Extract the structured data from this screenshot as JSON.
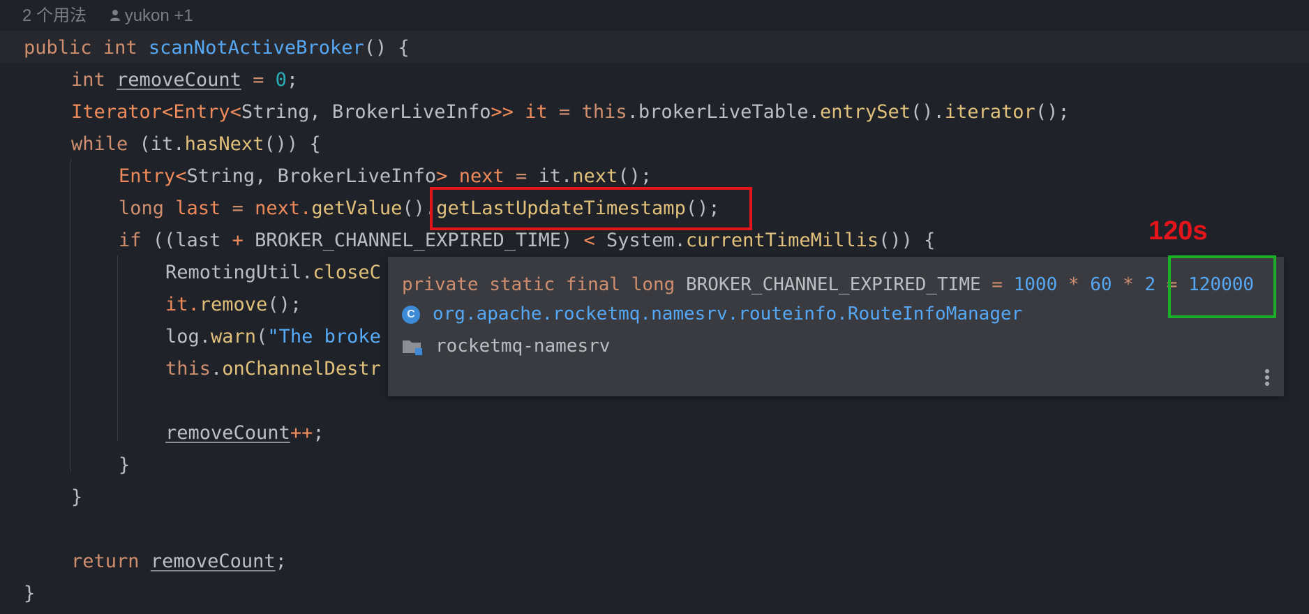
{
  "usage": {
    "count_label": "2 个用法",
    "author": "yukon +1"
  },
  "code": {
    "l1": {
      "kw1": "public",
      "kw2": "int",
      "name": "scanNotActiveBroker",
      "rest": "() {"
    },
    "l2": {
      "kw": "int",
      "var": "removeCount",
      "eq": " = ",
      "num": "0",
      "end": ";"
    },
    "l3": {
      "t1": "Iterator",
      "t2": "<",
      "t3": "Entry",
      "t4": "<",
      "t5": "String, BrokerLiveInfo",
      "t6": ">>",
      "var": " it",
      "eq": " = ",
      "kw": "this",
      "dot1": ".brokerLiveTable.",
      "m1": "entrySet",
      "p1": "().",
      "m2": "iterator",
      "end": "();"
    },
    "l4": {
      "kw": "while",
      "a": " (it.",
      "m": "hasNext",
      "b": "()) {"
    },
    "l5": {
      "t1": "Entry",
      "t2": "<",
      "t3": "String, BrokerLiveInfo",
      "t4": ">",
      "var": " next",
      "eq": " = ",
      "a": "it.",
      "m": "next",
      "end": "();"
    },
    "l6": {
      "kw": "long",
      "var": " last",
      "eq": " = ",
      "a": "next.",
      "m1": "getValue",
      "b": "().",
      "m2": "getLastUpdateTimestamp",
      "end": "();"
    },
    "l7": {
      "kw": "if",
      "a": " ((last ",
      "op": "+",
      "b": " BROKER_CHANNEL_EXPIRED_TIME) ",
      "op2": "<",
      "c": " System.",
      "m": "currentTimeMillis",
      "end": "()) {"
    },
    "l8": {
      "a": "RemotingUtil.",
      "m": "closeC"
    },
    "l9": {
      "a": "it.",
      "m": "remove",
      "end": "();"
    },
    "l10": {
      "a": "log.",
      "m": "warn",
      "b": "(",
      "s": "\"The broke"
    },
    "l11": {
      "kw": "this",
      "a": ".",
      "m": "onChannelDestr"
    },
    "l13": {
      "var": "removeCount",
      "op": "++",
      "end": ";"
    },
    "l14": {
      "t": "}"
    },
    "l15": {
      "t": "}"
    },
    "l17": {
      "kw": "return",
      "var": "removeCount",
      "end": ";"
    },
    "l18": {
      "t": "}"
    }
  },
  "annotation": {
    "label": "120s",
    "color": "#e3151b"
  },
  "popup": {
    "signature": {
      "modifiers": "private static final long",
      "name": " BROKER_CHANNEL_EXPIRED_TIME",
      "eq": " = ",
      "n1": "1000",
      "op1": " * ",
      "n2": "60",
      "op2": " * ",
      "n3": "2",
      "eq2": " = ",
      "value": "120000"
    },
    "class_icon": "class-icon",
    "class_letter": "C",
    "class_name": "org.apache.rocketmq.namesrv.routeinfo.RouteInfoManager",
    "module_icon": "module-folder-icon",
    "module_name": "rocketmq-namesrv",
    "more_icon": "more-vertical-icon"
  }
}
